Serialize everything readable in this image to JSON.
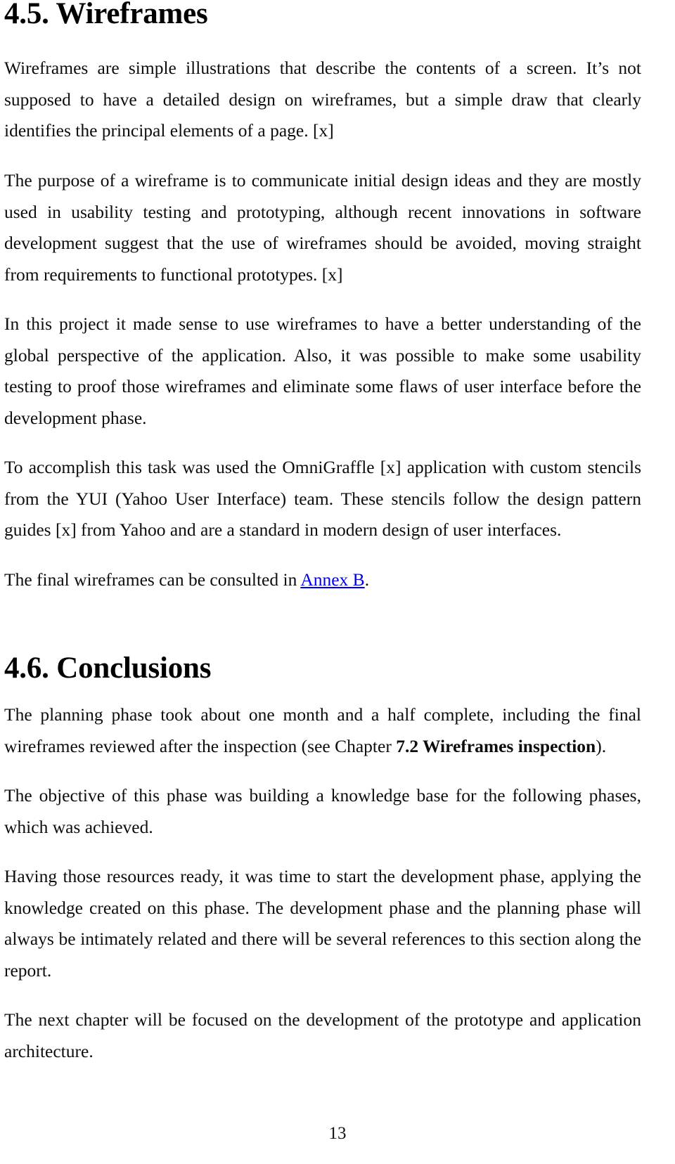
{
  "document": {
    "page_number": "13"
  },
  "sections": [
    {
      "heading": "4.5. Wireframes",
      "paragraphs": [
        {
          "id": "par-1",
          "text": "Wireframes are simple illustrations that describe the contents of a screen. It’s not supposed to have a detailed design on wireframes, but a simple draw that clearly identifies the principal elements of a page. [x]"
        },
        {
          "id": "par-2",
          "text": "The purpose of a wireframe is to communicate initial design ideas and they are mostly used in usability testing and prototyping, although recent innovations in software development suggest that the use of wireframes should be avoided, moving straight from requirements to functional prototypes. [x]"
        },
        {
          "id": "par-3",
          "text": "In this project it made sense to use wireframes to have a better understanding of the global perspective of the application. Also, it was possible to make some usability testing to proof those wireframes and eliminate some flaws of user interface before the development phase."
        },
        {
          "id": "par-4",
          "text": "To accomplish this task was used the OmniGraffle [x] application with custom stencils from the YUI (Yahoo User Interface) team. These stencils follow the design pattern guides [x] from Yahoo and are a standard in modern design of user interfaces."
        },
        {
          "id": "par-5",
          "text_before_link": "The final wireframes can be consulted in ",
          "link_text": "Annex B",
          "text_after_link": "."
        }
      ]
    },
    {
      "heading": "4.6. Conclusions",
      "paragraphs": [
        {
          "id": "par-6",
          "text_before_bold": "The planning phase took about one month and a half complete, including the final wireframes reviewed after the inspection (see Chapter ",
          "bold_text": "7.2 Wireframes inspection",
          "text_after_bold": ")."
        },
        {
          "id": "par-7",
          "text": "The objective of this phase was building a knowledge base for the following phases, which was achieved."
        },
        {
          "id": "par-8",
          "text": "Having those resources ready, it was time to start the development phase, applying the knowledge created on this phase. The development phase and the planning phase will always be intimately related and there will be several references to this section along the report."
        },
        {
          "id": "par-9",
          "text": "The next chapter will be focused on the development of the prototype and application architecture."
        }
      ]
    }
  ]
}
